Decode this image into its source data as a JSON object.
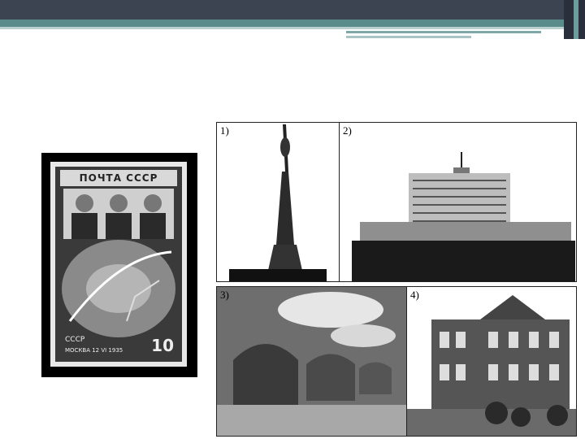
{
  "stamp": {
    "header": "ПОЧТА СССР",
    "country": "СССР",
    "city_date": "МОСКВА 12 VI 1935",
    "value": "10"
  },
  "photos": [
    {
      "label": "1)"
    },
    {
      "label": "2)"
    },
    {
      "label": "3)"
    },
    {
      "label": "4)"
    }
  ]
}
